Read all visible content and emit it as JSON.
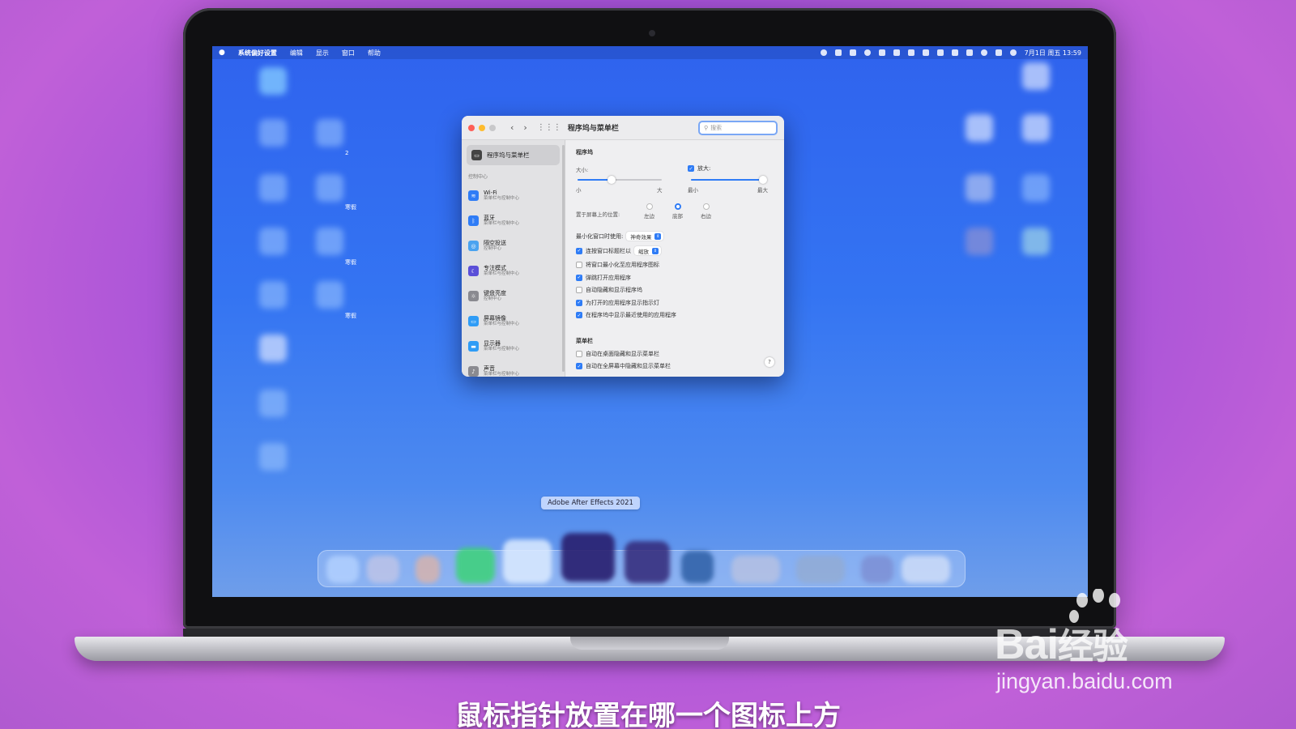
{
  "menubar": {
    "app": "系统偏好设置",
    "items": [
      "编辑",
      "显示",
      "窗口",
      "帮助"
    ],
    "datetime": "7月1日 周五 13:59"
  },
  "desktop_labels": [
    "2",
    "寒假",
    "寒假",
    "寒假"
  ],
  "window": {
    "title": "程序坞与菜单栏",
    "search_placeholder": "搜索"
  },
  "sidebar": {
    "selected": "程序坞与菜单栏",
    "section": "控制中心",
    "items": [
      {
        "name": "Wi-Fi",
        "sub": "菜单栏与控制中心",
        "icon": "wifi-icon",
        "color": "#2f7cf6"
      },
      {
        "name": "蓝牙",
        "sub": "菜单栏与控制中心",
        "icon": "bluetooth-icon",
        "color": "#2f7cf6"
      },
      {
        "name": "隔空投送",
        "sub": "控制中心",
        "icon": "airdrop-icon",
        "color": "#4aa3f0"
      },
      {
        "name": "专注模式",
        "sub": "菜单栏与控制中心",
        "icon": "moon-icon",
        "color": "#5b4fd8"
      },
      {
        "name": "键盘亮度",
        "sub": "控制中心",
        "icon": "keyboard-brightness-icon",
        "color": "#8a8a90"
      },
      {
        "name": "屏幕镜像",
        "sub": "菜单栏与控制中心",
        "icon": "screen-mirroring-icon",
        "color": "#2f9cf6"
      },
      {
        "name": "显示器",
        "sub": "菜单栏与控制中心",
        "icon": "display-icon",
        "color": "#2f9cf6"
      },
      {
        "name": "声音",
        "sub": "菜单栏与控制中心",
        "icon": "sound-icon",
        "color": "#8a8a90"
      }
    ]
  },
  "dock_settings": {
    "section": "程序坞",
    "size_label": "大小:",
    "size_min": "小",
    "size_max": "大",
    "size_value": 0.4,
    "magnify_label": "放大:",
    "magnify_checked": true,
    "magnify_min": "最小",
    "magnify_max": "最大",
    "magnify_value": 0.97,
    "position_label": "置于屏幕上的位置:",
    "position_options": [
      "左边",
      "底部",
      "右边"
    ],
    "position_selected": "底部",
    "minimize_label": "最小化窗口时使用:",
    "minimize_value": "神奇效果",
    "dblclick_label": "连按窗口标题栏以",
    "dblclick_value": "缩放",
    "checks": [
      {
        "label": "将窗口最小化至应用程序图标",
        "checked": false
      },
      {
        "label": "弹跳打开应用程序",
        "checked": true
      },
      {
        "label": "自动隐藏和显示程序坞",
        "checked": false
      },
      {
        "label": "为打开的应用程序显示指示灯",
        "checked": true
      },
      {
        "label": "在程序坞中显示最近使用的应用程序",
        "checked": true
      }
    ]
  },
  "menubar_settings": {
    "section": "菜单栏",
    "checks": [
      {
        "label": "自动在桌面隐藏和显示菜单栏",
        "checked": false
      },
      {
        "label": "自动在全屏幕中隐藏和显示菜单栏",
        "checked": true
      }
    ]
  },
  "help": "?",
  "tooltip": "Adobe After Effects 2021",
  "watermark": {
    "brand": "Bai",
    "brand_cn": "经验",
    "url": "jingyan.baidu.com"
  },
  "subtitle": "鼠标指针放置在哪一个图标上方"
}
